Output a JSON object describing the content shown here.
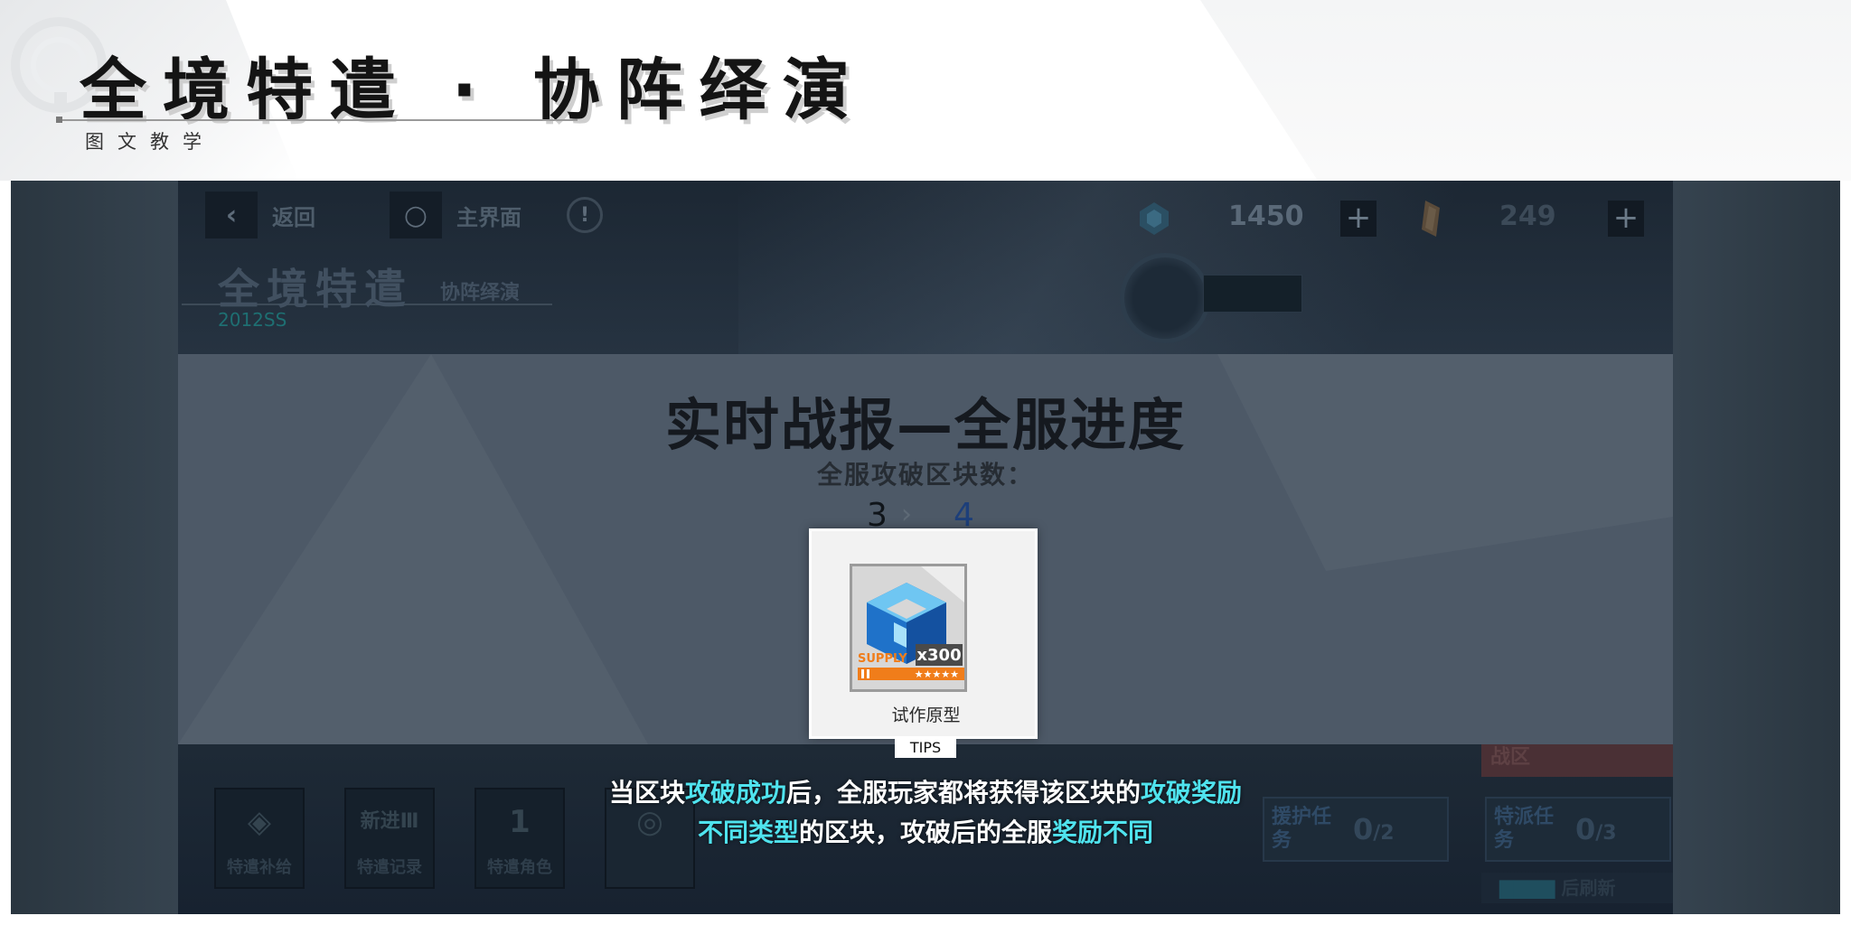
{
  "header": {
    "title": "全境特遣 · 协阵绎演",
    "subtitle": "图文教学"
  },
  "game": {
    "topbar": {
      "back_label": "返回",
      "home_label": "主界面",
      "resource1_value": "1450",
      "resource2_value": "249"
    },
    "event_title": "全境特遣",
    "event_subtitle": "协阵绎演",
    "event_id": "2012SS",
    "report": {
      "title": "实时战报—全服进度",
      "subtitle": "全服攻破区块数：",
      "count_from": "3",
      "count_to": "4"
    },
    "bottom": {
      "buttons": [
        {
          "label": "特遣补给",
          "icon": "supply-icon",
          "glyph": "◈"
        },
        {
          "label": "特遣记录",
          "icon": "record-icon",
          "glyph": "新进Ⅲ"
        },
        {
          "label": "特遣角色",
          "icon": "character-icon",
          "glyph": "1"
        },
        {
          "label": "",
          "icon": "unknown-icon",
          "glyph": "◎"
        }
      ],
      "battle_zone_label": "战区",
      "escort_task_label": "援护任务",
      "escort_task_value": "0",
      "escort_task_total": "/2",
      "dispatch_task_label": "特派任务",
      "dispatch_task_value": "0",
      "dispatch_task_total": "/3",
      "refresh_label": "后刷新"
    }
  },
  "reward": {
    "name": "试作原型",
    "quantity": "x300",
    "badge_text": "SUPPLY",
    "stars": "★★★★★"
  },
  "tips_label": "TIPS",
  "caption": {
    "line1": [
      {
        "text": "当区块",
        "hl": false
      },
      {
        "text": "攻破成功",
        "hl": true
      },
      {
        "text": "后，全服玩家都将获得该区块的",
        "hl": false
      },
      {
        "text": "攻破奖励",
        "hl": true
      }
    ],
    "line2": [
      {
        "text": "不同类型",
        "hl": true
      },
      {
        "text": "的区块，攻破后的全服",
        "hl": false
      },
      {
        "text": "奖励不同",
        "hl": true
      }
    ]
  },
  "colors": {
    "highlight": "#4fe3ee",
    "caption_text": "#ffffff",
    "reward_orange": "#f07d1a"
  }
}
